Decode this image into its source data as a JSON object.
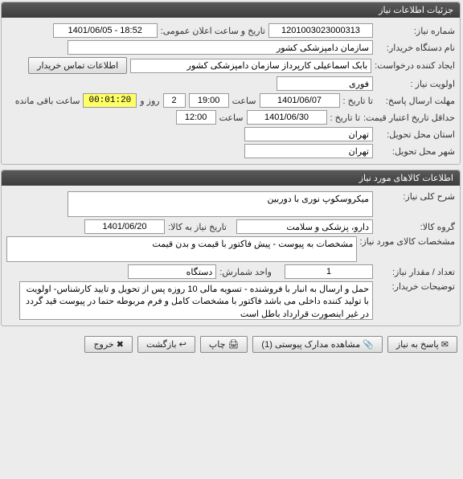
{
  "section1": {
    "title": "جزئیات اطلاعات نیاز",
    "needNo_label": "شماره نیاز:",
    "needNo": "1201003023000313",
    "announceDate_label": "تاریخ و ساعت اعلان عمومی:",
    "announceDate": "1401/06/05 - 18:52",
    "buyerOrg_label": "نام دستگاه خریدار:",
    "buyerOrg": "سازمان دامپزشکی کشور",
    "requester_label": "ایجاد کننده درخواست:",
    "requester": "بابک اسماعیلی کارپرداز سازمان دامپزشکی کشور",
    "contactBtn": "اطلاعات تماس خریدار",
    "priority_label": "اولویت نیاز :",
    "priority": "فوری",
    "deadline_label": "مهلت ارسال پاسخ:",
    "toDate_label": "تا تاریخ :",
    "toDate1": "1401/06/07",
    "time_label": "ساعت",
    "time1": "19:00",
    "days": "2",
    "days_suffix": "روز و",
    "timer": "00:01:20",
    "timer_suffix": "ساعت باقی مانده",
    "validity_label": "حداقل تاریخ اعتبار قیمت:",
    "toDate2": "1401/06/30",
    "time2": "12:00",
    "province_label": "استان محل تحویل:",
    "province": "تهران",
    "city_label": "شهر محل تحویل:",
    "city": "تهران"
  },
  "section2": {
    "title": "اطلاعات کالاهای مورد نیاز",
    "desc_label": "شرح کلی نیاز:",
    "desc": "میکروسکوپ نوری با دوربین",
    "group_label": "گروه کالا:",
    "group": "دارو، پزشکی و سلامت",
    "needDate_label": "تاریخ نیاز به کالا:",
    "needDate": "1401/06/20",
    "spec_label": "مشخصات کالای مورد نیاز:",
    "spec": "مشخصات به پیوست - پیش فاکتور با قیمت و بدن قیمت",
    "qty_label": "تعداد / مقدار نیاز:",
    "qty": "1",
    "unit_label": "واحد شمارش:",
    "unit": "دستگاه",
    "buyerNote_label": "توضیحات خریدار:",
    "buyerNote": "حمل و ارسال به انبار با فروشنده - تسویه مالی 10 روزه پس از تحویل و تایید کارشناس- اولویت با تولید کننده داخلی می باشد فاکتور با مشخصات کامل و فرم مربوطه حتما در پیوست قید گردد در غیر اینصورت قرارداد باطل است"
  },
  "footer": {
    "reply": "پاسخ به نیاز",
    "attachments": "مشاهده مدارک پیوستی (1)",
    "print": "چاپ",
    "back": "بازگشت",
    "exit": "خروج"
  }
}
